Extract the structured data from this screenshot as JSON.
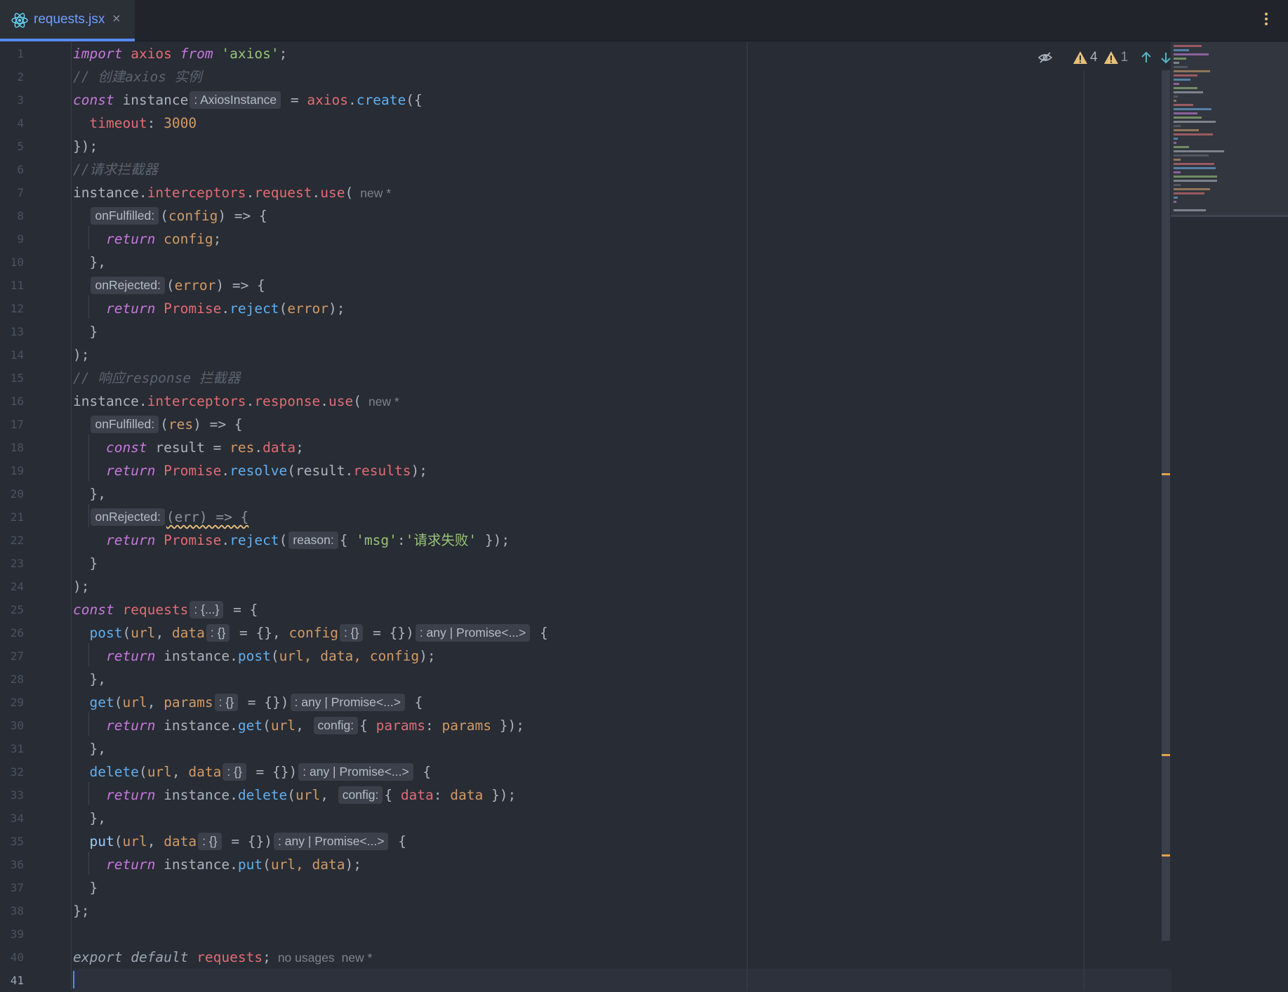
{
  "tab": {
    "filename": "requests.jsx",
    "close_glyph": "×",
    "icon": "react-icon"
  },
  "inspections": {
    "warning_count": "4",
    "weak_warning_count": "1",
    "icons": [
      "eye-slash-icon",
      "warning-icon",
      "weak-warning-icon",
      "arrow-up-icon",
      "arrow-down-icon"
    ]
  },
  "colors": {
    "keyword": "#c678dd",
    "identifier": "#e06c75",
    "function": "#61afef",
    "string": "#98c379",
    "number": "#d19a66",
    "comment": "#5c6370",
    "caret": "#528bff",
    "warning": "#e5c07b"
  },
  "code": {
    "l1": {
      "import": "import",
      "axios": "axios",
      "from": "from",
      "str": "'axios'",
      "end": ";"
    },
    "l2": {
      "comment": "// 创建axios 实例"
    },
    "l3": {
      "const": "const",
      "name": "instance",
      "hint": ": AxiosInstance",
      "eq": " = ",
      "obj": "axios",
      "dot": ".",
      "fn": "create",
      "rest": "({"
    },
    "l4": {
      "key": "timeout",
      "colon": ": ",
      "val": "3000"
    },
    "l5": {
      "text": "});"
    },
    "l6": {
      "comment": "//请求拦截器"
    },
    "l7": {
      "obj": "instance",
      "p1": "interceptors",
      "p2": "request",
      "fn": "use",
      "paren": "(",
      "inlay": "new *"
    },
    "l8": {
      "hint": "onFulfilled:",
      "open": "(",
      "param": "config",
      "rest": ") => {"
    },
    "l9": {
      "ret": "return",
      "val": "config",
      "end": ";"
    },
    "l10": {
      "text": "},"
    },
    "l11": {
      "hint": "onRejected:",
      "open": "(",
      "param": "error",
      "rest": ") => {"
    },
    "l12": {
      "ret": "return",
      "obj": "Promise",
      "fn": "reject",
      "open": "(",
      "arg": "error",
      "end": ");"
    },
    "l13": {
      "text": "}"
    },
    "l14": {
      "text": ");"
    },
    "l15": {
      "comment": "// 响应response 拦截器"
    },
    "l16": {
      "obj": "instance",
      "p1": "interceptors",
      "p2": "response",
      "fn": "use",
      "paren": "(",
      "inlay": "new *"
    },
    "l17": {
      "hint": "onFulfilled:",
      "open": "(",
      "param": "res",
      "rest": ") => {"
    },
    "l18": {
      "const": "const",
      "name": "result",
      "eq": " = ",
      "obj": "res",
      "prop": "data",
      "end": ";"
    },
    "l19": {
      "ret": "return",
      "obj": "Promise",
      "fn": "resolve",
      "open": "(",
      "arg": "result",
      "prop": "results",
      "end": ");"
    },
    "l20": {
      "text": "},"
    },
    "l21": {
      "hint": "onRejected:",
      "text": "(err) => {"
    },
    "l22": {
      "ret": "return",
      "obj": "Promise",
      "fn": "reject",
      "open": "(",
      "hint": "reason:",
      "brace": "{ ",
      "key": "'msg'",
      "colon": ":",
      "val": "'请求失败'",
      "end": " });"
    },
    "l23": {
      "text": "}"
    },
    "l24": {
      "text": ");"
    },
    "l25": {
      "const": "const",
      "name": "requests",
      "hint": ": {...}",
      "rest": " = {"
    },
    "l26": {
      "fn": "post",
      "open": "(",
      "a1": "url",
      "sep": ", ",
      "a2": "data",
      "h1": ": {}",
      "d1": " = {}, ",
      "a3": "config",
      "h2": ": {}",
      "d2": " = {})",
      "rh": ": any | Promise<...>",
      "end": " {"
    },
    "l27": {
      "ret": "return",
      "obj": "instance",
      "fn": "post",
      "open": "(",
      "args": "url, data, config",
      "end": ");"
    },
    "l28": {
      "text": "},"
    },
    "l29": {
      "fn": "get",
      "open": "(",
      "a1": "url",
      "sep": ", ",
      "a2": "params",
      "h1": ": {}",
      "d1": " = {})",
      "rh": ": any | Promise<...>",
      "end": " {"
    },
    "l30": {
      "ret": "return",
      "obj": "instance",
      "fn": "get",
      "open": "(",
      "a1": "url",
      "sep": ", ",
      "hint": "config:",
      "brace": "{ ",
      "key": "params",
      "colon": ": ",
      "val": "params",
      "end": " });"
    },
    "l31": {
      "text": "},"
    },
    "l32": {
      "fn": "delete",
      "open": "(",
      "a1": "url",
      "sep": ", ",
      "a2": "data",
      "h1": ": {}",
      "d1": " = {})",
      "rh": ": any | Promise<...>",
      "end": " {"
    },
    "l33": {
      "ret": "return",
      "obj": "instance",
      "fn": "delete",
      "open": "(",
      "a1": "url",
      "sep": ", ",
      "hint": "config:",
      "brace": "{ ",
      "key": "data",
      "colon": ": ",
      "val": "data",
      "end": " });"
    },
    "l34": {
      "text": "},"
    },
    "l35": {
      "fn": "put",
      "open": "(",
      "a1": "url",
      "sep": ", ",
      "a2": "data",
      "h1": ": {}",
      "d1": " = {})",
      "rh": ": any | Promise<...>",
      "end": " {"
    },
    "l36": {
      "ret": "return",
      "obj": "instance",
      "fn": "put",
      "open": "(",
      "args": "url, data",
      "end": ");"
    },
    "l37": {
      "text": "}"
    },
    "l38": {
      "text": "};"
    },
    "l40": {
      "export": "export",
      "default": "default",
      "name": "requests",
      "end": ";",
      "usages": "no usages",
      "inlay": "new *"
    }
  },
  "line_numbers": [
    "1",
    "2",
    "3",
    "4",
    "5",
    "6",
    "7",
    "8",
    "9",
    "10",
    "11",
    "12",
    "13",
    "14",
    "15",
    "16",
    "17",
    "18",
    "19",
    "20",
    "21",
    "22",
    "23",
    "24",
    "25",
    "26",
    "27",
    "28",
    "29",
    "30",
    "31",
    "32",
    "33",
    "34",
    "35",
    "36",
    "37",
    "38",
    "39",
    "40",
    "41"
  ],
  "current_line": "41"
}
